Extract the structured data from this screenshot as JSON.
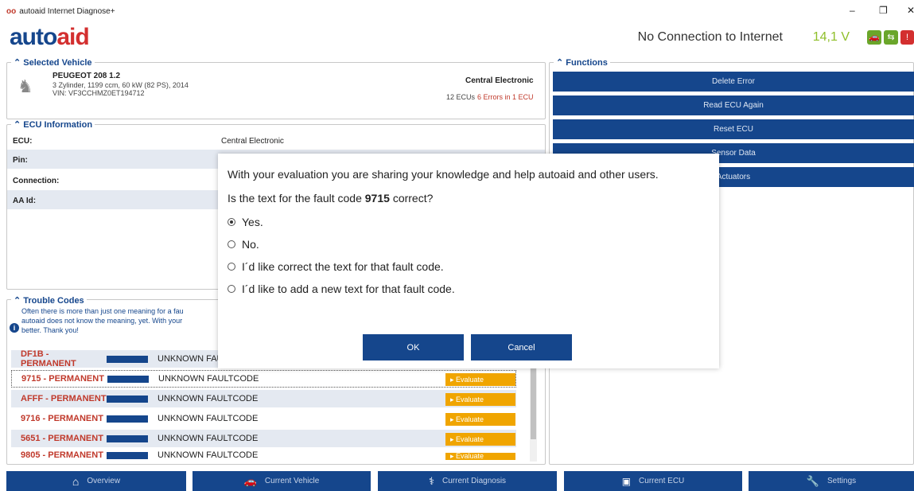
{
  "window": {
    "title": "autoaid Internet Diagnose+",
    "min": "–",
    "max": "❐",
    "close": "✕"
  },
  "header": {
    "logo_a": "auto",
    "logo_b": "aid",
    "connection": "No Connection to Internet",
    "voltage": "14,1 V"
  },
  "vehicle_panel": {
    "label": "Selected Vehicle",
    "name": "PEUGEOT 208 1.2",
    "details": "3 Zylinder, 1199 ccm, 60 kW (82 PS), 2014",
    "vin": "VIN: VF3CCHMZ0ET194712",
    "system": "Central Electronic",
    "ecus": "12 ECUs",
    "errors": "6 Errors in 1 ECU"
  },
  "ecu_panel": {
    "label": "ECU Information",
    "rows": [
      {
        "key": "ECU:",
        "value": "Central Electronic"
      },
      {
        "key": "Pin:",
        "value": ""
      },
      {
        "key": "Connection:",
        "value": ""
      },
      {
        "key": "AA Id:",
        "value": ""
      }
    ]
  },
  "functions_panel": {
    "label": "Functions",
    "buttons": [
      "Delete Error",
      "Read ECU Again",
      "Reset ECU",
      "Sensor Data",
      "Actuators"
    ]
  },
  "trouble_panel": {
    "label": "Trouble Codes",
    "info": [
      "Often there is more than just one meaning for a fau",
      "autoaid does not know the meaning, yet. With your",
      "better. Thank you!"
    ],
    "evaluate_label": "▸ Evaluate",
    "rows": [
      {
        "code": "DF1B - PERMANENT",
        "text": "UNKNOWN FAULTCODE"
      },
      {
        "code": "9715 - PERMANENT",
        "text": "UNKNOWN FAULTCODE"
      },
      {
        "code": "AFFF - PERMANENT",
        "text": "UNKNOWN FAULTCODE"
      },
      {
        "code": "9716 - PERMANENT",
        "text": "UNKNOWN FAULTCODE"
      },
      {
        "code": "5651 - PERMANENT",
        "text": "UNKNOWN FAULTCODE"
      },
      {
        "code": "9805 - PERMANENT",
        "text": "UNKNOWN FAULTCODE"
      }
    ]
  },
  "dialog": {
    "intro": "With your evaluation you are sharing your knowledge and help autoaid and other users.",
    "question_pre": "Is the text   for the fault code",
    "question_code": "9715",
    "question_post": "correct?",
    "options": [
      "Yes.",
      "No.",
      "I´d like correct the text for that fault code.",
      "I´d like to add a new text for that fault code."
    ],
    "selected_index": 0,
    "ok": "OK",
    "cancel": "Cancel"
  },
  "bottom_nav": [
    "Overview",
    "Current Vehicle",
    "Current Diagnosis",
    "Current ECU",
    "Settings"
  ],
  "colors": {
    "brand": "#15468c",
    "accent_red": "#c0392b",
    "evaluate": "#f0a500",
    "voltage": "#8fbf2a"
  }
}
